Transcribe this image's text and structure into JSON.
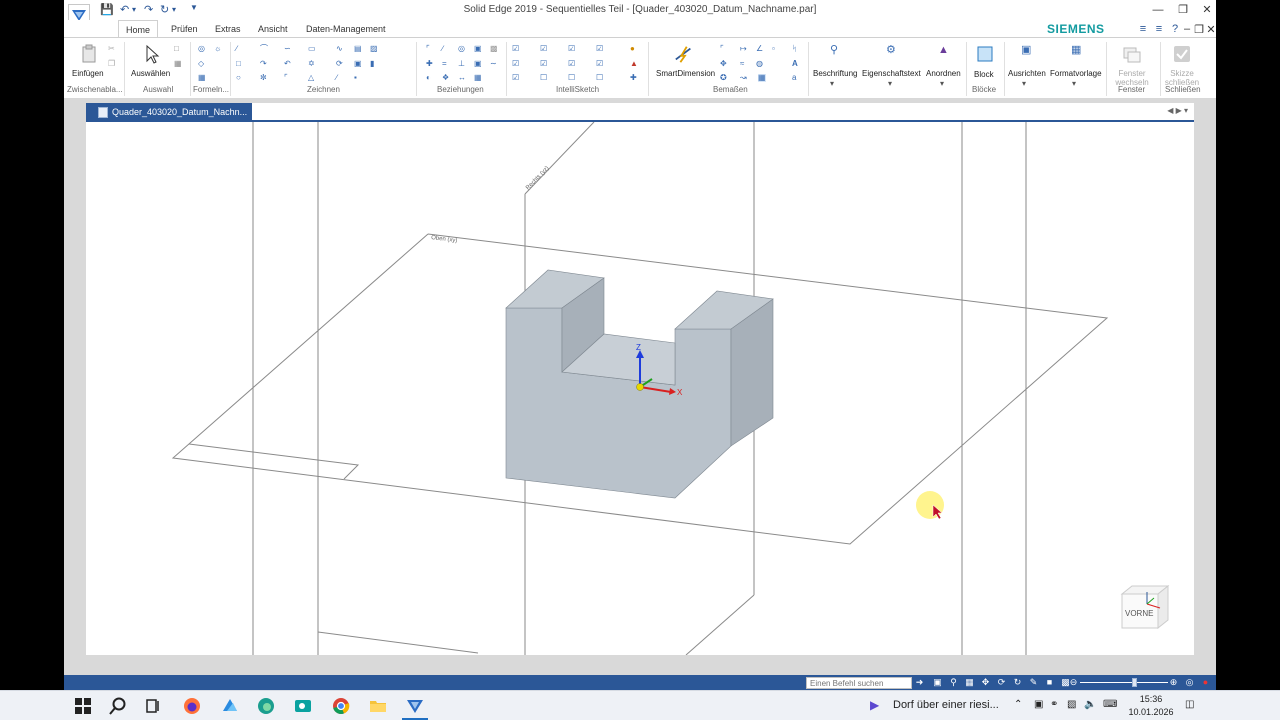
{
  "window": {
    "title": "Solid Edge 2019 - Sequentielles Teil - [Quader_403020_Datum_Nachname.par]",
    "brand": "SIEMENS",
    "brand_color": "#139ba0",
    "accent_color": "#2b5797"
  },
  "tabs": [
    {
      "label": "Home",
      "active": true
    },
    {
      "label": "Prüfen"
    },
    {
      "label": "Extras"
    },
    {
      "label": "Ansicht"
    },
    {
      "label": "Daten-Management"
    }
  ],
  "ribbon": {
    "buttons": {
      "einfuegen": "Einfügen",
      "auswaehlen": "Auswählen",
      "smartdimension": "SmartDimension",
      "beschriftung": "Beschriftung",
      "eigenschaftstext": "Eigenschaftstext",
      "anordnen": "Anordnen",
      "block": "Block",
      "ausrichten": "Ausrichten",
      "formatvorlage": "Formatvorlage",
      "fenster_wechseln": "Fenster wechseln",
      "skizze_schliessen": "Skizze schließen"
    },
    "groups": {
      "zwischenablage": "Zwischenabla...",
      "auswahl": "Auswahl",
      "formeln": "Formeln...",
      "zeichnen": "Zeichnen",
      "beziehungen": "Beziehungen",
      "intellisketch": "IntelliSketch",
      "bemassen": "Bemaßen",
      "bloecke": "Blöcke",
      "fenster": "Fenster",
      "schliessen": "Schließen"
    }
  },
  "document": {
    "tab_label": "Quader_403020_Datum_Nachn...",
    "plane_labels": {
      "right": "Rechts (yz)",
      "top": "Oben (xy)"
    },
    "triad": {
      "z": "Z",
      "x": "X"
    },
    "view_cube_label": "VORNE"
  },
  "statusbar": {
    "command_search_placeholder": "Einen Befehl suchen"
  },
  "taskbar": {
    "news": "Dorf über einer riesi...",
    "time": "15:36",
    "date": "10.01.2026"
  }
}
